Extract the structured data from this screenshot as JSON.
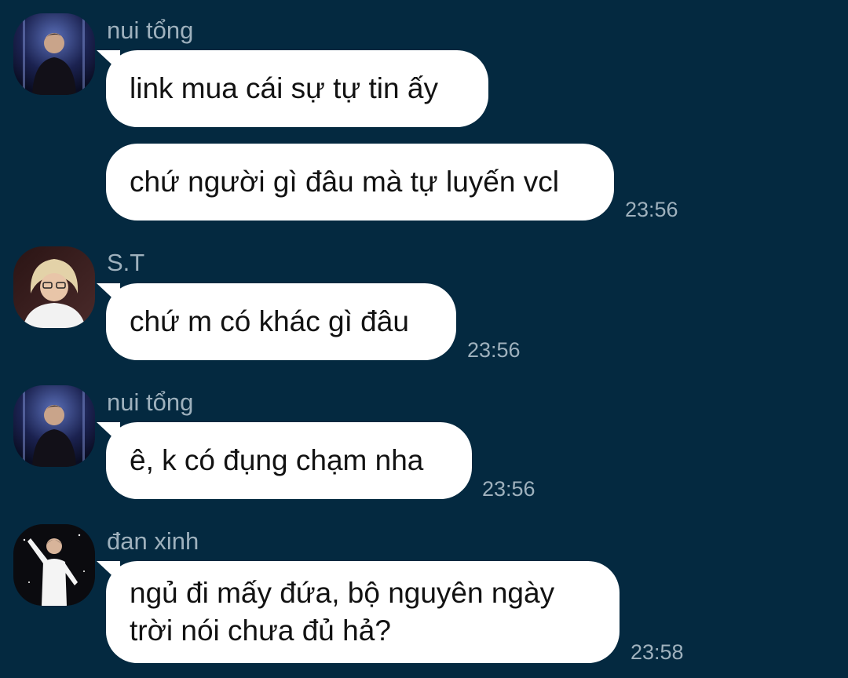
{
  "messages": [
    {
      "sender": "nui tổng",
      "avatar_icon": "user-avatar-dark-stage",
      "bubbles": [
        {
          "text": "link mua cái sự tự tin ấy"
        },
        {
          "text": "chứ người gì đâu mà tự luyến vcl",
          "time": "23:56"
        }
      ]
    },
    {
      "sender": "S.T",
      "avatar_icon": "user-avatar-blond",
      "bubbles": [
        {
          "text": "chứ m có khác gì đâu",
          "time": "23:56"
        }
      ]
    },
    {
      "sender": "nui tổng",
      "avatar_icon": "user-avatar-dark-stage",
      "bubbles": [
        {
          "text": "ê, k có đụng chạm nha",
          "time": "23:56"
        }
      ]
    },
    {
      "sender": "đan xinh",
      "avatar_icon": "user-avatar-white-suit",
      "bubbles": [
        {
          "lines": [
            "ngủ đi mấy đứa, bộ nguyên ngày",
            "trời nói chưa đủ hả?"
          ],
          "time": "23:58"
        }
      ]
    }
  ],
  "colors": {
    "background": "#042940",
    "bubble": "#ffffff",
    "meta_text": "#9fb1bd",
    "message_text": "#121212"
  }
}
